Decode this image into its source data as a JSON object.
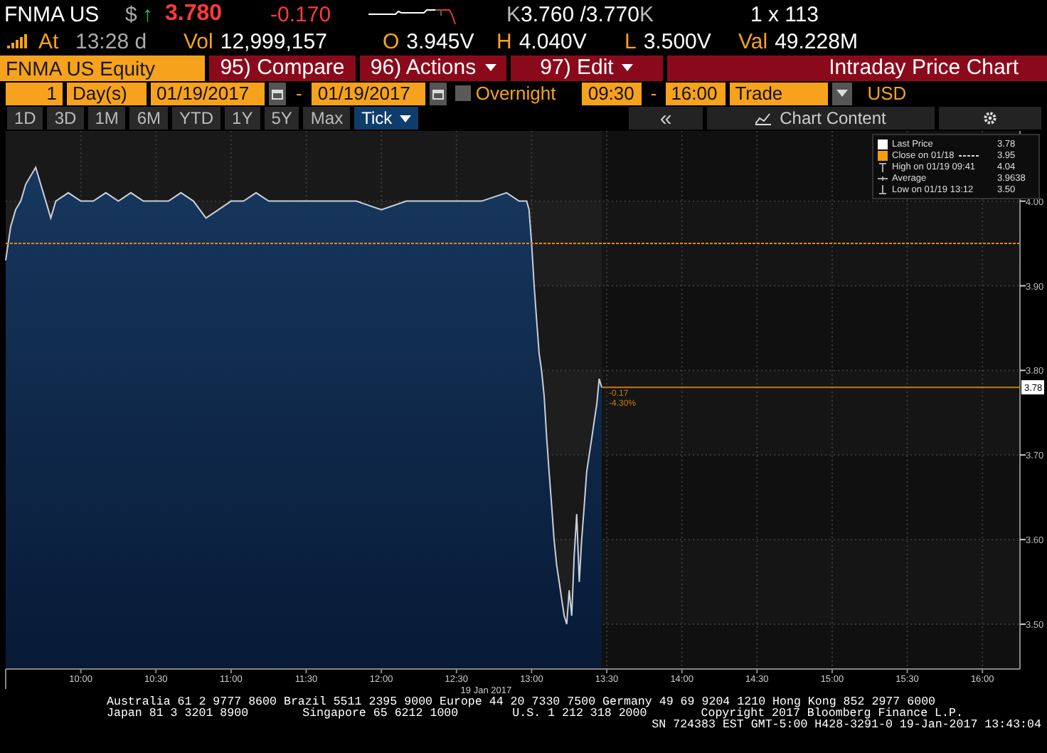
{
  "quote": {
    "ticker": "FNMA US",
    "currency": "$",
    "arrow": "↑",
    "last": "3.780",
    "change": "-0.170",
    "bid_prefix": "K",
    "bid_ask": "3.760 /3.770",
    "ask_suffix": "K",
    "size": "1 x 113"
  },
  "stats": {
    "at_label": "At",
    "time": "13:28 d",
    "items": [
      {
        "label": "Vol",
        "value": "12,999,157"
      },
      {
        "label": "O",
        "value": "3.945V"
      },
      {
        "label": "H",
        "value": "4.040V"
      },
      {
        "label": "L",
        "value": "3.500V"
      },
      {
        "label": "Val",
        "value": "49.228M"
      }
    ]
  },
  "command_bar": {
    "security": "FNMA US Equity",
    "buttons": [
      {
        "label": "95) Compare",
        "dropdown": false
      },
      {
        "label": "96) Actions",
        "dropdown": true
      },
      {
        "label": "97) Edit",
        "dropdown": true
      }
    ],
    "title": "Intraday Price Chart"
  },
  "range_bar": {
    "count": "1",
    "unit": "Day(s)",
    "start_date": "01/19/2017",
    "separator": "-",
    "end_date": "01/19/2017",
    "overnight": {
      "label": "Overnight",
      "checked": false
    },
    "start_time": "09:30",
    "time_separator": "-",
    "end_time": "16:00",
    "field": "Trade",
    "currency": "USD"
  },
  "period_tabs": [
    {
      "label": "1D",
      "selected": false
    },
    {
      "label": "3D",
      "selected": false
    },
    {
      "label": "1M",
      "selected": false
    },
    {
      "label": "6M",
      "selected": false
    },
    {
      "label": "YTD",
      "selected": false
    },
    {
      "label": "1Y",
      "selected": false
    },
    {
      "label": "5Y",
      "selected": false
    },
    {
      "label": "Max",
      "selected": false
    },
    {
      "label": "Tick",
      "selected": true
    }
  ],
  "chart_tools": {
    "collapse": "«",
    "content": "Chart Content"
  },
  "legend": [
    {
      "kind": "swatch",
      "color": "#ffffff",
      "label": "Last Price",
      "value": "3.78"
    },
    {
      "kind": "dashed",
      "color": "#f39c12",
      "label": "Close on 01/18",
      "value": "3.95"
    },
    {
      "kind": "high",
      "label": "High on 01/19 09:41",
      "value": "4.04"
    },
    {
      "kind": "average",
      "label": "Average",
      "value": "3.9638"
    },
    {
      "kind": "low",
      "label": "Low on 01/19 13:12",
      "value": "3.50"
    }
  ],
  "chart": {
    "date_label": "19 Jan 2017",
    "change_labels": [
      "-0.17",
      "-4.30%"
    ],
    "chart_data": {
      "type": "area",
      "x": [
        570,
        572,
        574,
        576,
        578,
        580,
        582,
        584,
        586,
        588,
        590,
        595,
        600,
        605,
        610,
        615,
        620,
        625,
        630,
        635,
        640,
        645,
        650,
        655,
        660,
        665,
        670,
        675,
        680,
        690,
        700,
        710,
        720,
        730,
        740,
        750,
        760,
        770,
        775,
        778,
        779,
        780,
        781,
        782,
        783,
        784,
        785,
        786,
        787,
        788,
        789,
        790,
        791,
        792,
        793,
        794,
        795,
        796,
        797,
        798,
        799,
        800,
        801,
        802,
        803,
        804,
        805,
        806,
        807,
        808
      ],
      "series": [
        {
          "color": "#17375e",
          "values": [
            3.93,
            3.97,
            3.99,
            4.0,
            4.02,
            4.03,
            4.04,
            4.02,
            4.0,
            3.98,
            4.0,
            4.01,
            4.0,
            4.0,
            4.01,
            4.0,
            4.01,
            4.0,
            4.0,
            4.0,
            4.01,
            4.0,
            3.98,
            3.99,
            4.0,
            4.0,
            4.01,
            4.0,
            4.0,
            4.0,
            4.0,
            4.0,
            3.99,
            4.0,
            4.0,
            4.0,
            4.0,
            4.01,
            4.0,
            4.0,
            3.99,
            3.95,
            3.9,
            3.86,
            3.82,
            3.8,
            3.77,
            3.72,
            3.68,
            3.64,
            3.6,
            3.57,
            3.55,
            3.53,
            3.51,
            3.5,
            3.54,
            3.51,
            3.58,
            3.63,
            3.55,
            3.6,
            3.64,
            3.68,
            3.7,
            3.72,
            3.74,
            3.76,
            3.79,
            3.78
          ]
        }
      ],
      "xlim": [
        570,
        975
      ],
      "ylim": [
        3.447,
        4.083
      ],
      "xticks": [
        {
          "value": 600,
          "label": "10:00"
        },
        {
          "value": 630,
          "label": "10:30"
        },
        {
          "value": 660,
          "label": "11:00"
        },
        {
          "value": 690,
          "label": "11:30"
        },
        {
          "value": 720,
          "label": "12:00"
        },
        {
          "value": 750,
          "label": "12:30"
        },
        {
          "value": 780,
          "label": "13:00"
        },
        {
          "value": 810,
          "label": "13:30"
        },
        {
          "value": 840,
          "label": "14:00"
        },
        {
          "value": 870,
          "label": "14:30"
        },
        {
          "value": 900,
          "label": "15:00"
        },
        {
          "value": 930,
          "label": "15:30"
        },
        {
          "value": 960,
          "label": "16:00"
        }
      ],
      "yticks": [
        {
          "value": 3.5,
          "label": "3.50"
        },
        {
          "value": 3.6,
          "label": "3.60"
        },
        {
          "value": 3.7,
          "label": "3.70"
        },
        {
          "value": 3.8,
          "label": "3.80"
        },
        {
          "value": 3.9,
          "label": "3.90"
        },
        {
          "value": 4.0,
          "label": "4.00"
        }
      ],
      "grid": true,
      "ref_lines": [
        {
          "axis": "y",
          "value": 3.95,
          "color": "#e08a10"
        },
        {
          "axis": "y",
          "value": 3.78,
          "color": "#c87a10",
          "label": "3.78"
        }
      ]
    }
  },
  "footer": [
    [
      "Australia 61 2 9777 8600 Brazil 5511 2395 9000 Europe 44 20 7330 7500 Germany 49 69 9204 1210 Hong Kong 852 2977 6000"
    ],
    [
      "Japan 81 3 3201 8900",
      "Singapore 65 6212 1000",
      "U.S. 1 212 318 2000",
      "Copyright 2017 Bloomberg Finance L.P."
    ],
    [
      "SN 724383 EST  GMT-5:00 H428-3291-0 19-Jan-2017 13:43:04"
    ]
  ]
}
